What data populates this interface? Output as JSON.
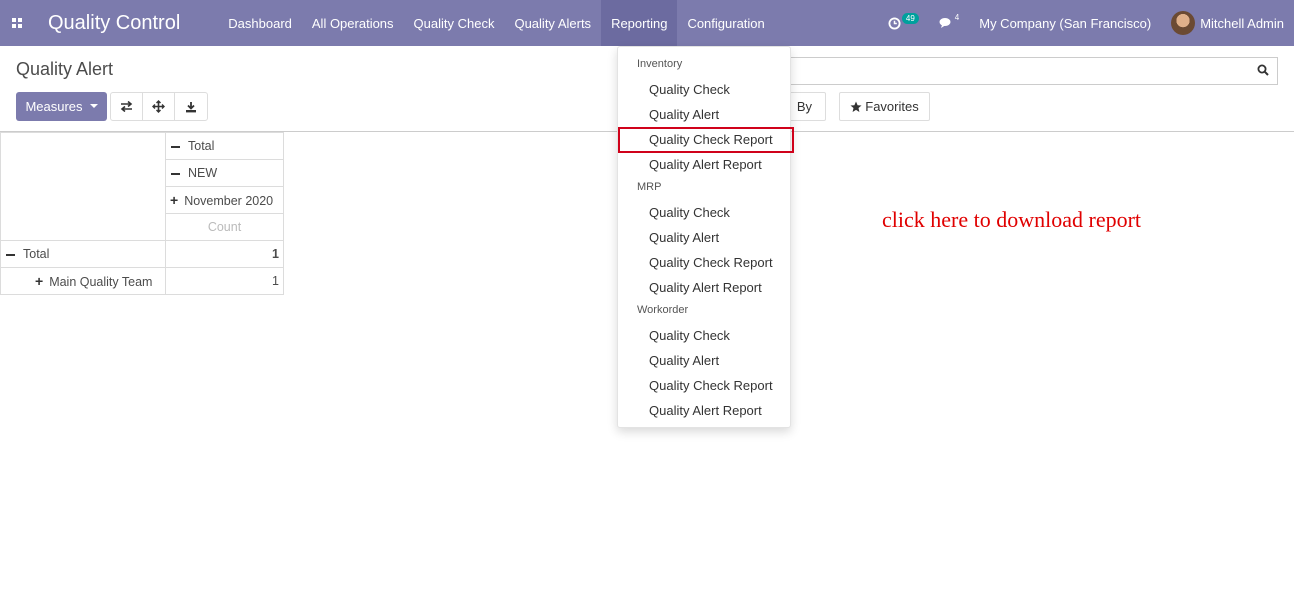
{
  "navbar": {
    "app_title": "Quality Control",
    "menu": [
      "Dashboard",
      "All Operations",
      "Quality Check",
      "Quality Alerts",
      "Reporting",
      "Configuration"
    ],
    "active_menu": "Reporting",
    "activity_count": "49",
    "messages_count": "4",
    "company": "My Company (San Francisco)",
    "user": "Mitchell Admin",
    "accent_color": "#7c7bad"
  },
  "control_panel": {
    "breadcrumb": "Quality Alert",
    "measures_label": "Measures",
    "groupby_label": "By",
    "favorites_label": "Favorites"
  },
  "pivot": {
    "col_total": "Total",
    "col_status": "NEW",
    "col_date": "November 2020",
    "measure": "Count",
    "row_total_label": "Total",
    "row_total_value": "1",
    "row_team_label": "Main Quality Team",
    "row_team_value": "1"
  },
  "reporting_menu": {
    "sections": [
      {
        "header": "Inventory",
        "items": [
          "Quality Check",
          "Quality Alert",
          "Quality Check Report",
          "Quality Alert Report"
        ]
      },
      {
        "header": "MRP",
        "items": [
          "Quality Check",
          "Quality Alert",
          "Quality Check Report",
          "Quality Alert Report"
        ]
      },
      {
        "header": "Workorder",
        "items": [
          "Quality Check",
          "Quality Alert",
          "Quality Check Report",
          "Quality Alert Report"
        ]
      }
    ],
    "highlighted_item": "Quality Check Report"
  },
  "annotation_text": "click here to download report",
  "annotation_color": "#e00000"
}
